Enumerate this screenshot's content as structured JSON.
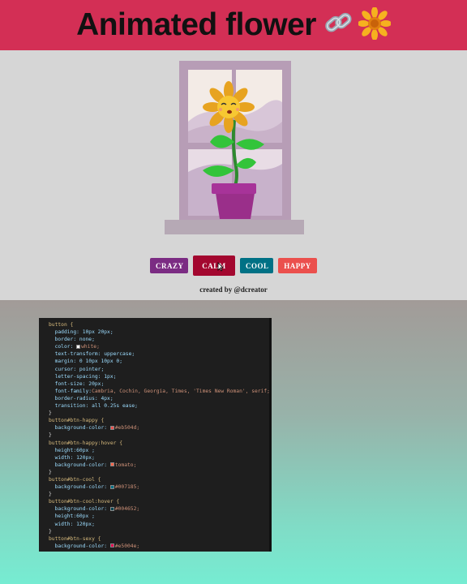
{
  "header": {
    "title": "Animated flower",
    "emoji_1": "🔗",
    "emoji_2": "🌼"
  },
  "colors": {
    "header_bg": "#d32f55",
    "btn_crazy": "#7b2c83",
    "btn_calm": "#a3072f",
    "btn_cool": "#007185",
    "btn_happy": "#eb504d"
  },
  "buttons": [
    {
      "label": "CRAZY"
    },
    {
      "label": "CALM"
    },
    {
      "label": "COOL"
    },
    {
      "label": "HAPPY"
    }
  ],
  "credit": "created by @dcreator",
  "code": {
    "l1_sel": "button {",
    "l2": "padding: 10px 20px;",
    "l3": "border: none;",
    "l4_prop": "color: ",
    "l4_val": "white;",
    "l5": "text-transform: uppercase;",
    "l6": "margin: 0 10px 10px 0;",
    "l7": "cursor: pointer;",
    "l8": "letter-spacing: 1px;",
    "l9": "font-size: 20px;",
    "l10_prop": "font-family:",
    "l10_val": "Cambria, Cochin, Georgia, Times, 'Times New Roman', serif;",
    "l11": "border-radius: 4px;",
    "l12": "transition: all 0.25s ease;",
    "l13": "}",
    "l14": "button#btn-happy {",
    "l15_prop": "background-color: ",
    "l15_val": "#eb504d;",
    "l16": "}",
    "l17": "button#btn-happy:hover {",
    "l18": "height:60px ;",
    "l19": "width: 120px;",
    "l20_prop": "background-color: ",
    "l20_val": "tomato;",
    "l21": "}",
    "l22": "button#btn-cool {",
    "l23_prop": "background-color: ",
    "l23_val": "#007185;",
    "l24": "}",
    "l25": "button#btn-cool:hover {",
    "l26_prop": "background-color: ",
    "l26_val": "#004652;",
    "l27": "height:60px ;",
    "l28": "width: 120px;",
    "l29": "}",
    "l30": "button#btn-sexy {",
    "l31_prop": "background-color: ",
    "l31_val": "#e5004e;"
  }
}
